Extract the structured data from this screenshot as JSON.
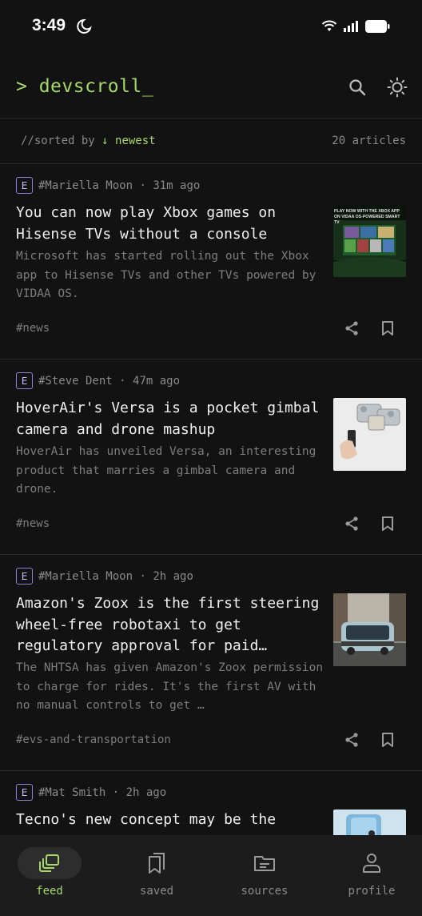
{
  "status": {
    "time": "3:49"
  },
  "header": {
    "title": "> devscroll_"
  },
  "sort": {
    "prefix": "//sorted by",
    "value": "↓ newest",
    "count": "20 articles"
  },
  "articles": [
    {
      "source_badge": "E",
      "author": "#Mariella Moon",
      "time": "31m ago",
      "title": "You can now play Xbox games on Hisense TVs without a console",
      "description": "Microsoft has started rolling out the Xbox app to Hisense TVs and other TVs powered by VIDAA OS.",
      "tag": "#news",
      "thumb_text": "PLAY NOW WITH THE XBOX APP ON VIDAA OS-POWERED SMART TV"
    },
    {
      "source_badge": "E",
      "author": "#Steve Dent",
      "time": "47m ago",
      "title": "HoverAir's Versa is a pocket gimbal camera and drone mashup",
      "description": "HoverAir has unveiled Versa, an interesting product that marries a gimbal camera and drone.",
      "tag": "#news"
    },
    {
      "source_badge": "E",
      "author": "#Mariella Moon",
      "time": "2h ago",
      "title": "Amazon's Zoox is the first steering wheel-free robotaxi to get regulatory approval for paid…",
      "description": "The NHTSA has given Amazon's Zoox permission to charge for rides. It's the first AV with no manual controls to get …",
      "tag": "#evs-and-transportation"
    },
    {
      "source_badge": "E",
      "author": "#Mat Smith",
      "time": "2h ago",
      "title": "Tecno's new concept may be the"
    }
  ],
  "nav": [
    {
      "label": "feed",
      "icon": "feed-icon",
      "active": true
    },
    {
      "label": "saved",
      "icon": "bookmarks-icon",
      "active": false
    },
    {
      "label": "sources",
      "icon": "folder-icon",
      "active": false
    },
    {
      "label": "profile",
      "icon": "person-icon",
      "active": false
    }
  ],
  "colors": {
    "accent": "#a6d96a",
    "badge": "#8f82d6",
    "background": "#121212",
    "nav_bg": "#1c1c1c"
  }
}
